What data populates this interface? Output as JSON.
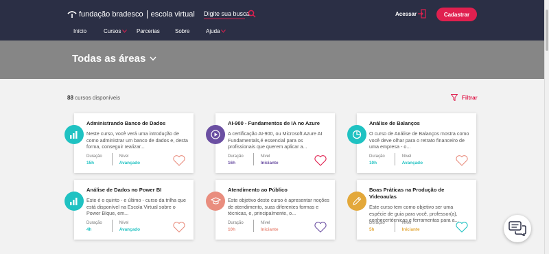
{
  "header": {
    "logo_brand": "fundação bradesco",
    "logo_product": "escola virtual",
    "search_placeholder": "Digite sua busca",
    "login_label": "Acessar",
    "signup_label": "Cadastrar",
    "nav": [
      "Início",
      "Cursos",
      "Parcerias",
      "Sobre",
      "Ajuda"
    ]
  },
  "hero": {
    "title": "Todas as áreas"
  },
  "results": {
    "count": "88",
    "count_suffix": "cursos disponíveis",
    "filter_label": "Filtrar"
  },
  "colors": {
    "header_bg": "#2b2f45",
    "accent": "#e0204f",
    "teal": "#1fc2c2",
    "purple": "#6b4fa2",
    "coral": "#e98d7e",
    "gold": "#e3a83a"
  },
  "labels": {
    "duration": "Duração",
    "level": "Nível"
  },
  "cards": [
    {
      "title": "Administrando Banco de Dados",
      "desc": "Neste curso, você verá uma introdução de como administrar um banco de dados e, desta forma, conseguir realizar...",
      "duration": "15h",
      "level": "Avançado",
      "icon": "chart-icon"
    },
    {
      "title": "AI-900 - Fundamentos de IA no Azure",
      "desc": "A certificação AI-900, ou Microsoft Azure AI Fundamentals,é essencial para os profissionais que querem aplicar a...",
      "duration": "16h",
      "level": "Iniciante",
      "icon": "play-icon"
    },
    {
      "title": "Análise de Balanços",
      "desc": "O curso de Análise de Balanços mostra como você deve olhar para o retrato financeiro de uma empresa - o...",
      "duration": "10h",
      "level": "Avançado",
      "icon": "pie-chart-icon"
    },
    {
      "title": "Análise de Dados no Power BI",
      "desc": "Este é o quinto - e último - curso da trilha que está disponível na Escola Virtual sobre o Power BIque, em...",
      "duration": "4h",
      "level": "Avançado",
      "icon": "chart-icon"
    },
    {
      "title": "Atendimento ao Público",
      "desc": "Este objetivo deste curso é apresentar noções de atendimento, suas diferentes formas e técnicas, e, principalmente, o...",
      "duration": "10h",
      "level": "Iniciante",
      "icon": "graduation-cap-icon"
    },
    {
      "title": "Boas Práticas na Produção de Videoaulas",
      "desc": "Este curso tem como objetivo ser uma espécie de guia para você, professor(a), conhecertécnicas e ferramentas para a...",
      "duration": "5h",
      "level": "Iniciante",
      "icon": "pencil-icon"
    }
  ]
}
